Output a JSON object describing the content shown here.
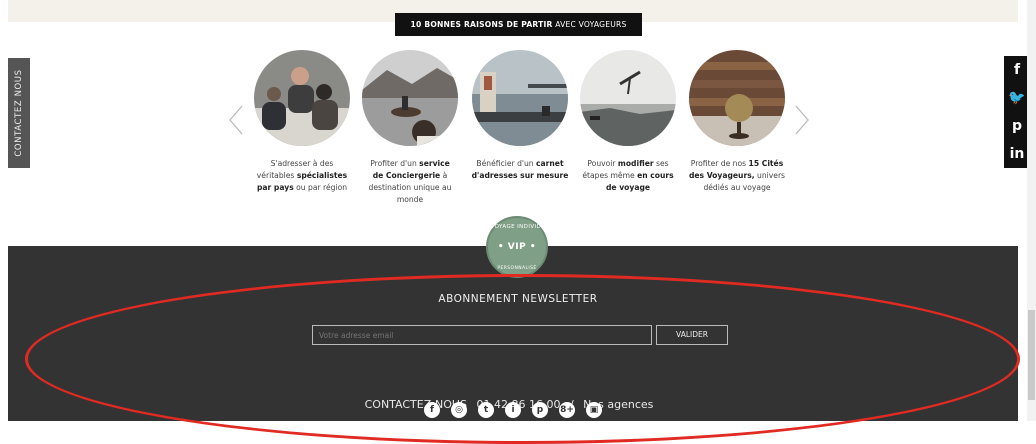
{
  "banner": {
    "bold": "10 BONNES RAISONS DE PARTIR",
    "rest": "AVEC VOYAGEURS"
  },
  "contact_tab": "CONTACTEZ NOUS",
  "social_side": [
    "f",
    "🐦",
    "p",
    "in"
  ],
  "reasons": [
    {
      "lines": [
        "S'adresser à des",
        "véritables spécialistes",
        "par pays ou par région"
      ]
    },
    {
      "lines": [
        "Profiter d'un service",
        "de Conciergerie à",
        "destination unique au",
        "monde"
      ]
    },
    {
      "lines": [
        "Bénéficier d'un carnet",
        "d'adresses sur mesure"
      ]
    },
    {
      "lines": [
        "Pouvoir modifier ses",
        "étapes même en cours",
        "de voyage"
      ]
    },
    {
      "lines": [
        "Profiter de nos 15 Cités",
        "des Voyageurs, univers",
        "dédiés au voyage"
      ]
    }
  ],
  "vip": {
    "top": "LE VOYAGE INDIVIDUEL",
    "center": "• VIP •",
    "bottom": "PERSONNALISÉ"
  },
  "newsletter": {
    "title": "ABONNEMENT NEWSLETTER",
    "placeholder": "Votre adresse email",
    "submit": "VALIDER"
  },
  "contact": {
    "label": "CONTACTEZ-NOUS",
    "phone": "01 42 86 16 00",
    "sep": "/",
    "agencies": "Nos agences"
  },
  "footer_social": [
    "f",
    "◎",
    "t",
    "i",
    "p",
    "8+",
    "▣"
  ],
  "colors": {
    "footer": "#333333",
    "highlight": "#e02a22",
    "vip": "#7f9f86"
  }
}
